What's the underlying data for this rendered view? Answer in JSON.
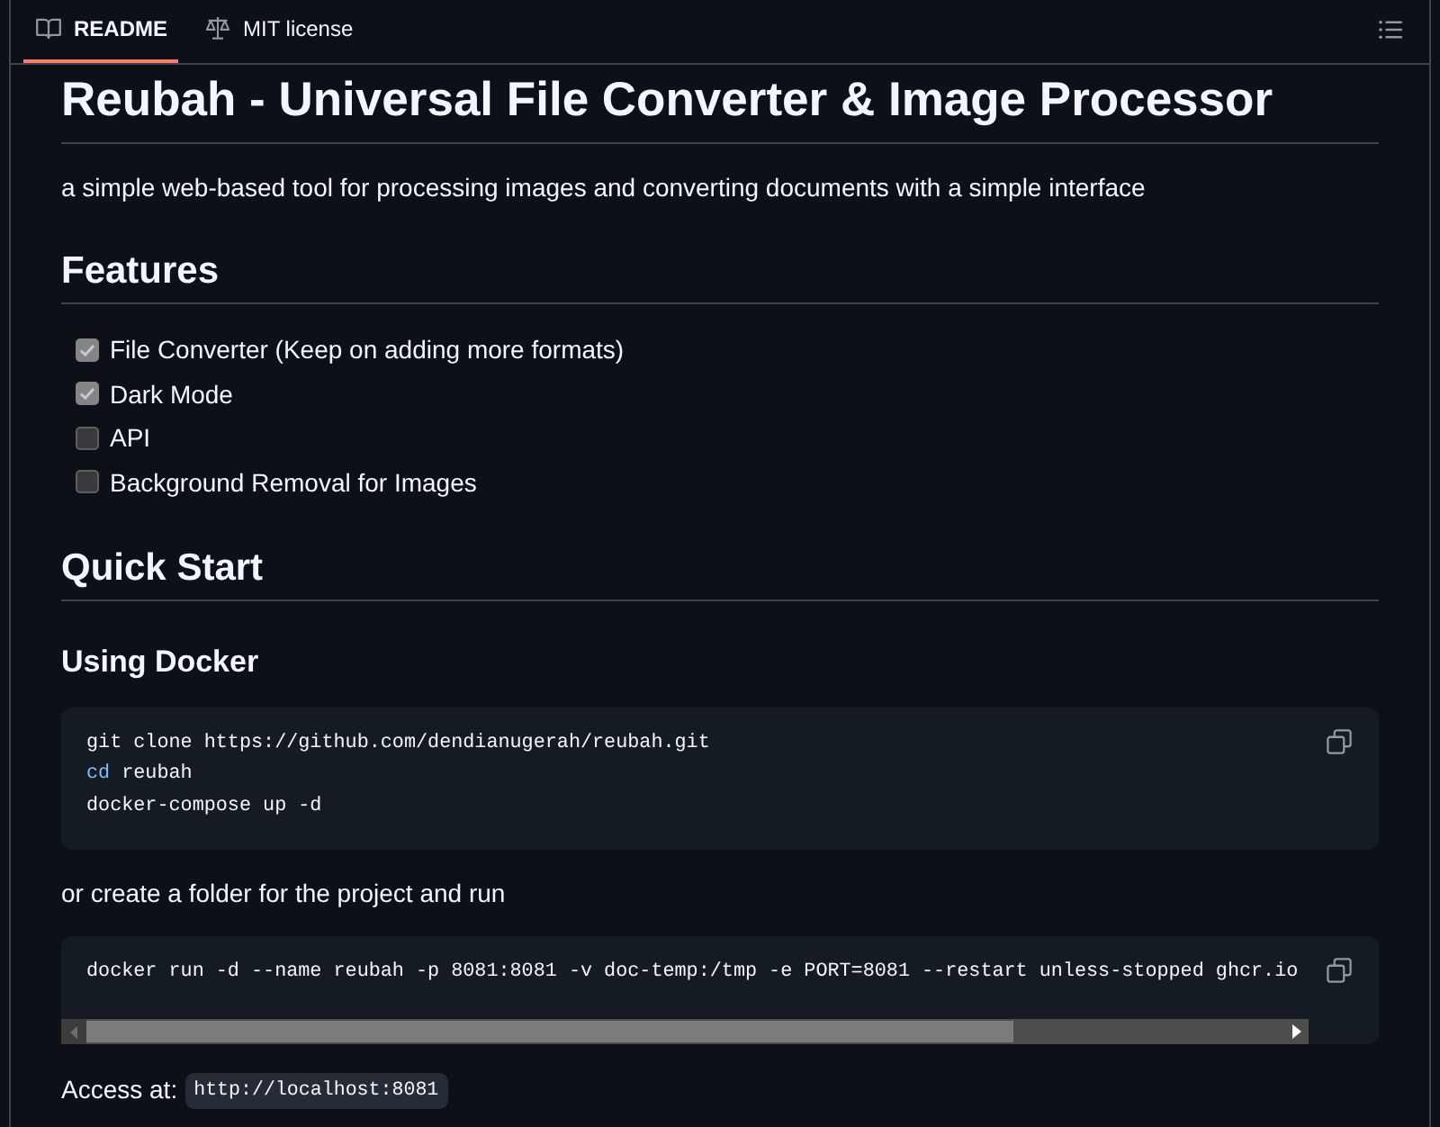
{
  "tabs": [
    {
      "label": "README",
      "selected": true
    },
    {
      "label": "MIT license",
      "selected": false
    }
  ],
  "readme": {
    "blocks": [
      {
        "kind": "heading1",
        "text": "Reubah - Universal File Converter & Image Processor"
      },
      {
        "kind": "paragraph",
        "text": "a simple web-based tool for processing images and converting documents with a simple interface"
      },
      {
        "kind": "heading2",
        "text": "Features"
      },
      {
        "kind": "checklist",
        "items": [
          {
            "label": "File Converter (Keep on adding more formats)",
            "checked": true
          },
          {
            "label": "Dark Mode",
            "checked": true
          },
          {
            "label": "API",
            "checked": false
          },
          {
            "label": "Background Removal for Images",
            "checked": false
          }
        ]
      },
      {
        "kind": "heading2",
        "text": "Quick Start"
      },
      {
        "kind": "heading3",
        "text": "Using Docker"
      },
      {
        "kind": "code",
        "scrollbar": false,
        "lines": [
          {
            "tokens": [
              {
                "kind": "plain",
                "text": "git clone https://github.com/dendianugerah/reubah.git"
              }
            ]
          },
          {
            "tokens": [
              {
                "kind": "builtin",
                "text": "cd"
              },
              {
                "kind": "plain",
                "text": " reubah"
              }
            ]
          },
          {
            "tokens": [
              {
                "kind": "plain",
                "text": "docker-compose up -d"
              }
            ]
          }
        ]
      },
      {
        "kind": "paragraph",
        "text": "or create a folder for the project and run"
      },
      {
        "kind": "code",
        "scrollbar": true,
        "lines": [
          {
            "tokens": [
              {
                "kind": "plain",
                "text": "docker run -d --name reubah -p 8081:8081 -v doc-temp:/tmp -e PORT=8081 --restart unless-stopped ghcr.io"
              }
            ]
          }
        ]
      },
      {
        "kind": "access",
        "label": "Access at:",
        "code": "http://localhost:8081"
      }
    ]
  }
}
